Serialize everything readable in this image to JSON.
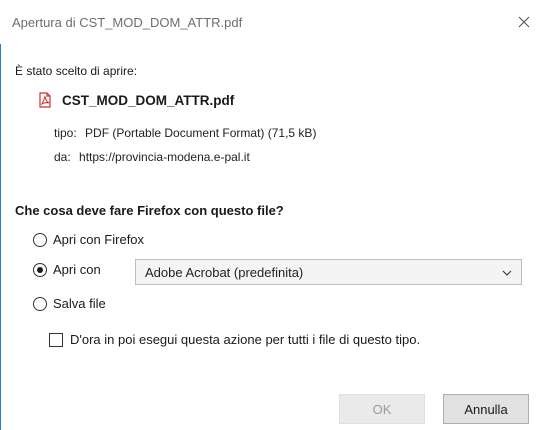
{
  "window": {
    "title": "Apertura di CST_MOD_DOM_ATTR.pdf",
    "close_icon": "close-icon"
  },
  "file": {
    "chosen_label": "È stato scelto di aprire:",
    "icon": "pdf-file-icon",
    "name": "CST_MOD_DOM_ATTR.pdf",
    "type_key": "tipo:",
    "type_value": "PDF (Portable Document Format) (71,5 kB)",
    "from_key": "da:",
    "from_value": "https://provincia-modena.e-pal.it"
  },
  "question": "Che cosa deve fare Firefox con questo file?",
  "options": {
    "open_with_firefox": {
      "label": "Apri con Firefox",
      "selected": false
    },
    "open_with": {
      "label": "Apri con",
      "selected": true
    },
    "save_file": {
      "label": "Salva file",
      "selected": false
    }
  },
  "app_select": {
    "value": "Adobe Acrobat (predefinita)",
    "icon": "chevron-down-icon"
  },
  "remember": {
    "label": "D'ora in poi esegui questa azione per tutti i file di questo tipo.",
    "checked": false
  },
  "buttons": {
    "ok": "OK",
    "cancel": "Annulla"
  },
  "colors": {
    "ok_disabled_text": "#9a9a9a",
    "pdf_red": "#d32f2f",
    "title_text": "#6e6e6e"
  }
}
